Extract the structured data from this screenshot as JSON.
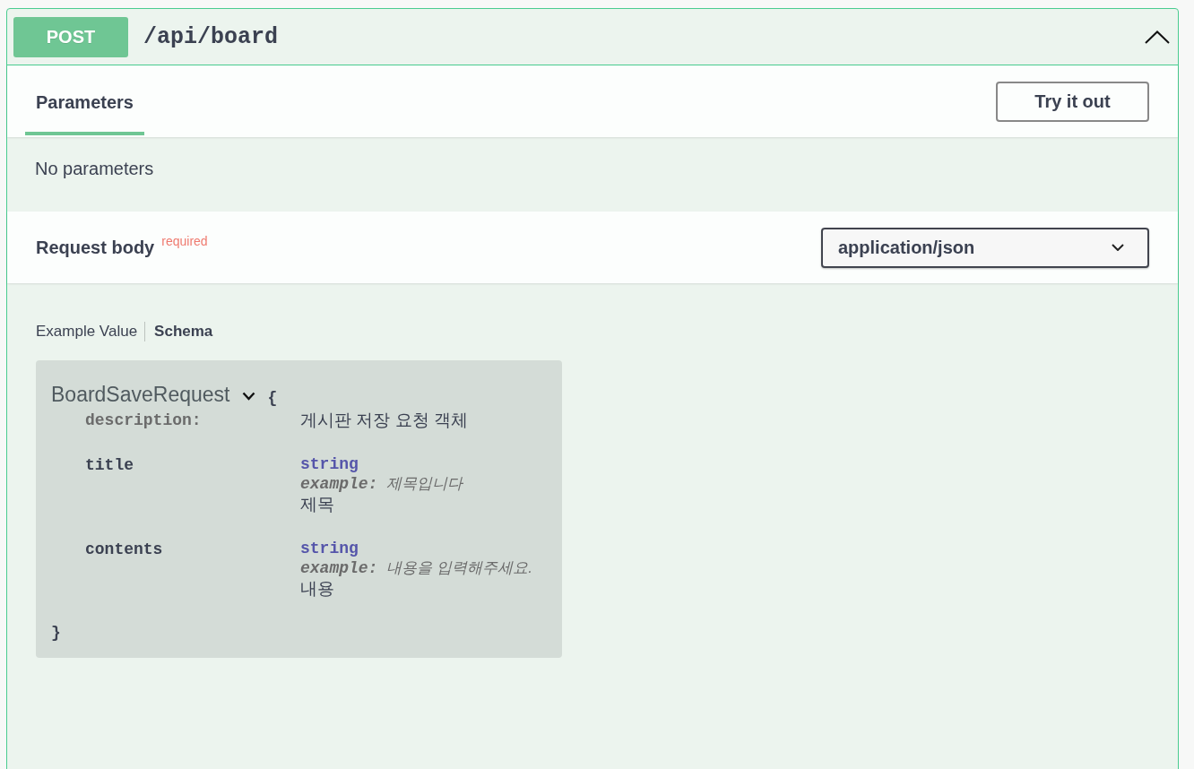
{
  "operation": {
    "method": "POST",
    "path": "/api/board",
    "expanded": true
  },
  "tabs": [
    {
      "label": "Parameters",
      "selected": true
    }
  ],
  "try_it_out_button": "Try it out",
  "parameters_message": "No parameters",
  "request_body": {
    "label": "Request body",
    "required_note": "required",
    "content_type": "application/json"
  },
  "model_tabs": [
    {
      "label": "Example Value",
      "selected": false
    },
    {
      "label": "Schema",
      "selected": true
    }
  ],
  "schema": {
    "name": "BoardSaveRequest",
    "expanded": true,
    "open_brace": "{",
    "close_brace": "}",
    "description_key": "description:",
    "description": "게시판 저장 요청 객체",
    "properties": [
      {
        "name": "title",
        "type": "string",
        "example_label": "example:",
        "example": "제목입니다",
        "description": "제목"
      },
      {
        "name": "contents",
        "type": "string",
        "example_label": "example:",
        "example": "내용을 입력해주세요.",
        "description": "내용"
      }
    ]
  }
}
